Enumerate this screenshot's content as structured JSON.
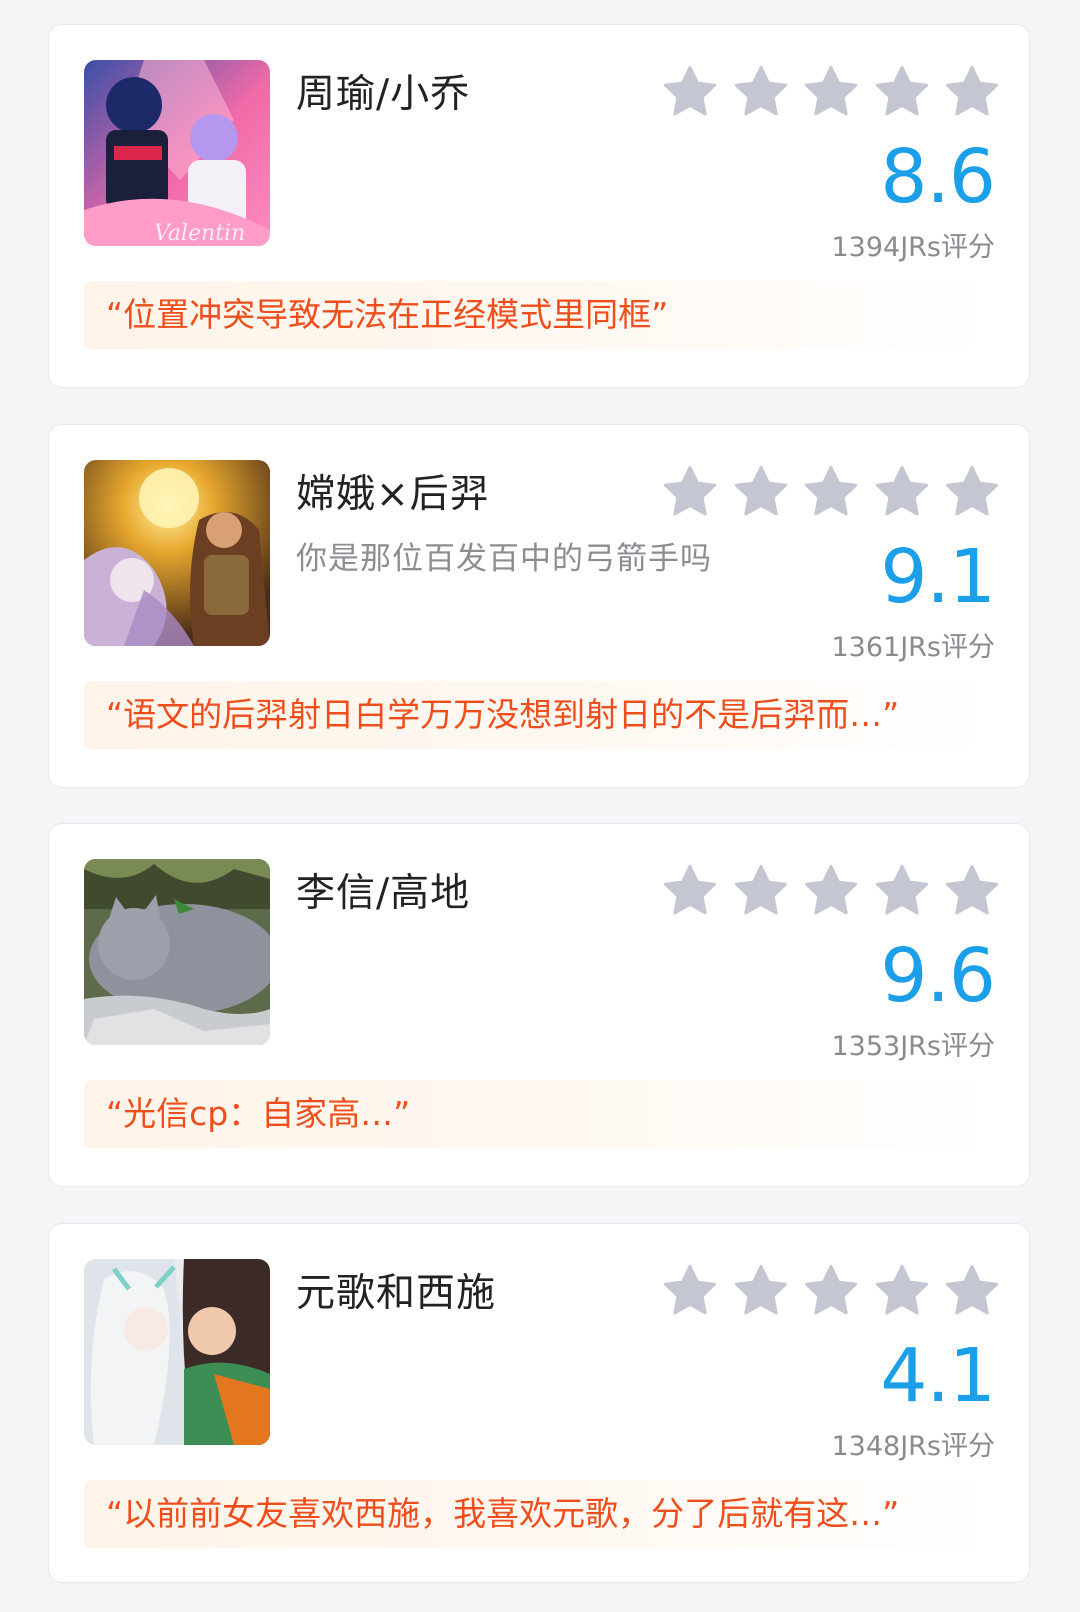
{
  "colors": {
    "background": "#f4f5f7",
    "card": "#ffffff",
    "score": "#1a9fe8",
    "star": "#c4c7d2",
    "quote_text": "#ef4e1c",
    "quote_bg": "#fff4e9"
  },
  "cards": [
    {
      "title": "周瑜/小乔",
      "subtitle": "",
      "score": "8.6",
      "rating_count": "1394JRs评分",
      "stars_filled": 0,
      "quote": "“位置冲突导致无法在正经模式里同框”",
      "thumb_icon": "couple-thumbnail"
    },
    {
      "title": "嫦娥×后羿",
      "subtitle": "你是那位百发百中的弓箭手吗",
      "score": "9.1",
      "rating_count": "1361JRs评分",
      "stars_filled": 0,
      "quote": "“语文的后羿射日白学万万没想到射日的不是后羿而…”",
      "thumb_icon": "couple-thumbnail"
    },
    {
      "title": "李信/高地",
      "subtitle": "",
      "score": "9.6",
      "rating_count": "1353JRs评分",
      "stars_filled": 0,
      "quote": "“光信cp：自家高…”",
      "thumb_icon": "cat-thumbnail"
    },
    {
      "title": "元歌和西施",
      "subtitle": "",
      "score": "4.1",
      "rating_count": "1348JRs评分",
      "stars_filled": 0,
      "quote": "“以前前女友喜欢西施，我喜欢元歌，分了后就有这…”",
      "thumb_icon": "couple-thumbnail"
    }
  ]
}
